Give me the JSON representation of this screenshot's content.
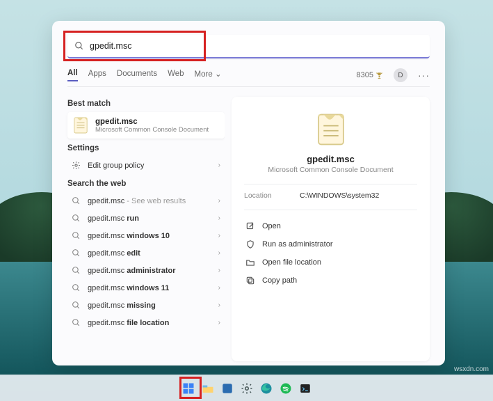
{
  "search": {
    "value": "gpedit.msc"
  },
  "tabs": [
    "All",
    "Apps",
    "Documents",
    "Web",
    "More"
  ],
  "account": {
    "points": "8305",
    "avatar_letter": "D"
  },
  "sections": {
    "best_match_header": "Best match",
    "best_match": {
      "title": "gpedit.msc",
      "subtitle": "Microsoft Common Console Document"
    },
    "settings_header": "Settings",
    "settings_item": "Edit group policy",
    "web_header": "Search the web",
    "web_suggestions": [
      {
        "prefix": "gpedit.msc",
        "suffix": " - See web results",
        "suffix_muted": true
      },
      {
        "prefix": "gpedit.msc",
        "suffix": " run"
      },
      {
        "prefix": "gpedit.msc",
        "suffix": " windows 10"
      },
      {
        "prefix": "gpedit.msc",
        "suffix": " edit"
      },
      {
        "prefix": "gpedit.msc",
        "suffix": " administrator"
      },
      {
        "prefix": "gpedit.msc",
        "suffix": " windows 11"
      },
      {
        "prefix": "gpedit.msc",
        "suffix": " missing"
      },
      {
        "prefix": "gpedit.msc",
        "suffix": " file location"
      }
    ]
  },
  "preview": {
    "title": "gpedit.msc",
    "subtitle": "Microsoft Common Console Document",
    "location_label": "Location",
    "location_value": "C:\\WINDOWS\\system32",
    "actions": [
      "Open",
      "Run as administrator",
      "Open file location",
      "Copy path"
    ]
  },
  "watermark": "wsxdn.com"
}
